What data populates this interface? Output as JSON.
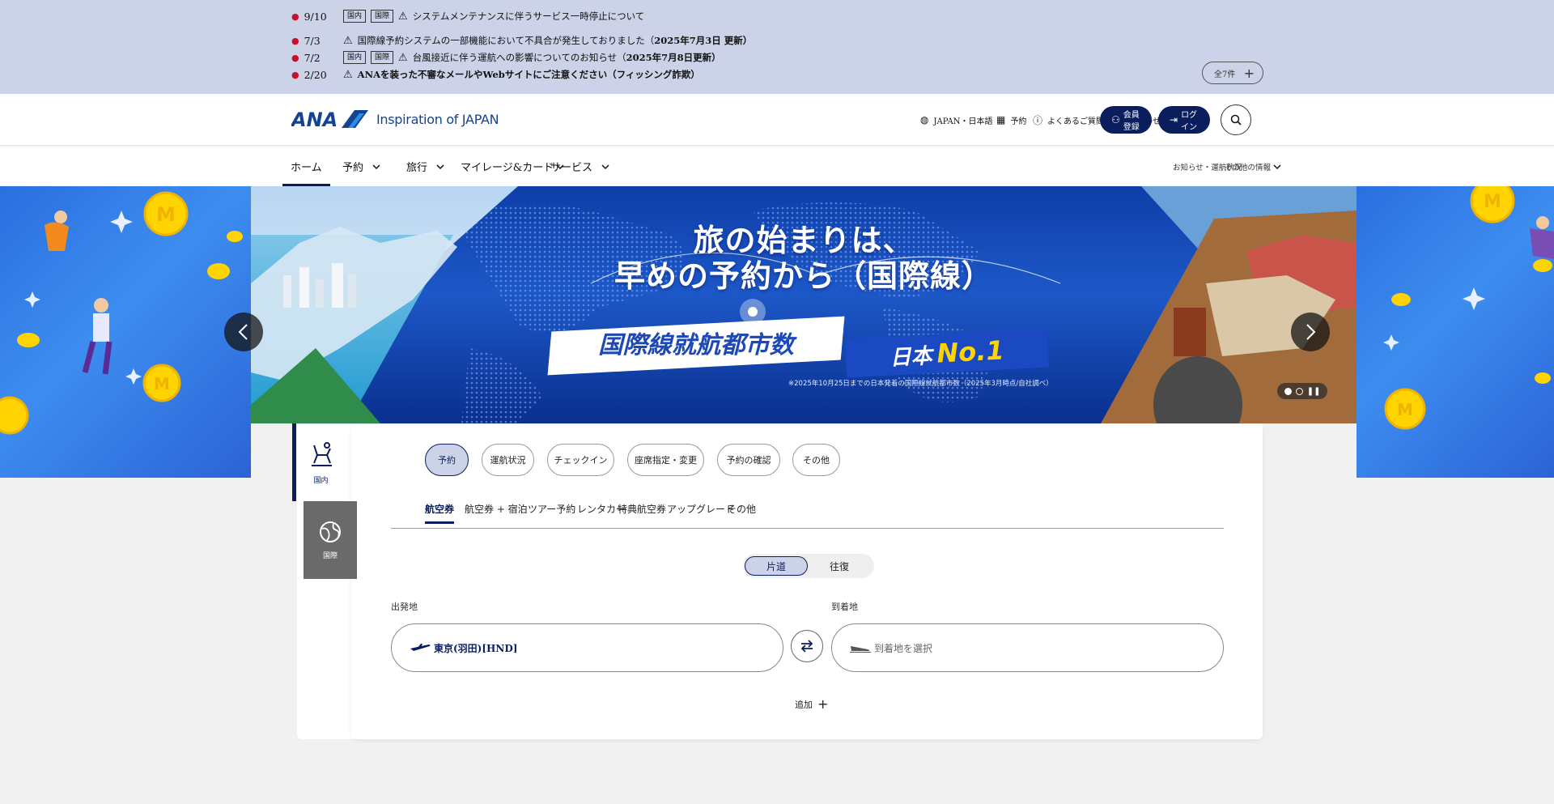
{
  "notices": [
    {
      "date": "9/10",
      "tags": [
        "国内",
        "国際"
      ],
      "text": "システムメンテナンスに伴うサービス一時停止について",
      "bold": ""
    },
    {
      "date": "7/3",
      "tags": [],
      "text": "国際線予約システムの一部機能において不具合が発生しておりました（",
      "bold": "2025年7月3日 更新）"
    },
    {
      "date": "7/2",
      "tags": [
        "国内",
        "国際"
      ],
      "text": "台風接近に伴う運航への影響についてのお知らせ（",
      "bold": "2025年7月8日更新）"
    },
    {
      "date": "2/20",
      "tags": [],
      "text": "ANAを装った不審なメールやWebサイトにご注意ください（フィッシング詐欺）",
      "bold": ""
    }
  ],
  "notice_more": {
    "label": "全7件"
  },
  "header": {
    "tagline": "Inspiration of JAPAN",
    "util": [
      {
        "label": "JAPAN・日本語",
        "icon": "globe-icon"
      },
      {
        "label": "予約",
        "icon": "calendar-icon"
      },
      {
        "label": "よくあるご質問・お問い合わせ",
        "icon": "help-icon"
      }
    ],
    "signup_label": "会員登録",
    "login_label": "ログイン"
  },
  "gnav": {
    "items": [
      {
        "label": "ホーム",
        "has_menu": false,
        "active": true
      },
      {
        "label": "予約",
        "has_menu": true,
        "active": false
      },
      {
        "label": "旅行",
        "has_menu": true,
        "active": false
      },
      {
        "label": "マイレージ&カード",
        "has_menu": true,
        "active": false
      },
      {
        "label": "サービス",
        "has_menu": true,
        "active": false
      }
    ],
    "right_link": "お知らせ・運航状況",
    "right_menu": "その他の情報"
  },
  "hero": {
    "title_line1": "旅の始まりは、",
    "title_line2": "早めの予約から（国際線）",
    "banner_text": "国際線就航都市数",
    "banner_jp": "日本",
    "banner_no1": "No.1",
    "footnote": "※2025年10月25日までの日本発着の国際線就航都市数（2025年3月時点/自社調べ）",
    "slide_count": 2,
    "active_slide": 1
  },
  "booking": {
    "side_tabs": [
      {
        "label": "国内",
        "icon": "seat-icon",
        "active": true
      },
      {
        "label": "国際",
        "icon": "globe-icon",
        "active": false
      }
    ],
    "chips": [
      {
        "label": "予約",
        "active": true
      },
      {
        "label": "運航状況",
        "active": false
      },
      {
        "label": "チェックイン",
        "active": false
      },
      {
        "label": "座席指定・変更",
        "active": false
      },
      {
        "label": "予約の確認",
        "active": false
      },
      {
        "label": "その他",
        "active": false
      }
    ],
    "subtabs": [
      {
        "label": "航空券",
        "active": true
      },
      {
        "label": "航空券 + 宿泊",
        "active": false
      },
      {
        "label": "ツアー予約",
        "active": false
      },
      {
        "label": "レンタカー",
        "active": false
      },
      {
        "label": "特典航空券",
        "active": false
      },
      {
        "label": "アップグレード",
        "active": false
      },
      {
        "label": "その他",
        "active": false
      }
    ],
    "trip_type": {
      "options": [
        "片道",
        "往復"
      ],
      "selected": "片道"
    },
    "from_label": "出発地",
    "to_label": "到着地",
    "from_value": "東京(羽田)[HND]",
    "to_placeholder": "到着地を選択",
    "add_label": "追加"
  }
}
